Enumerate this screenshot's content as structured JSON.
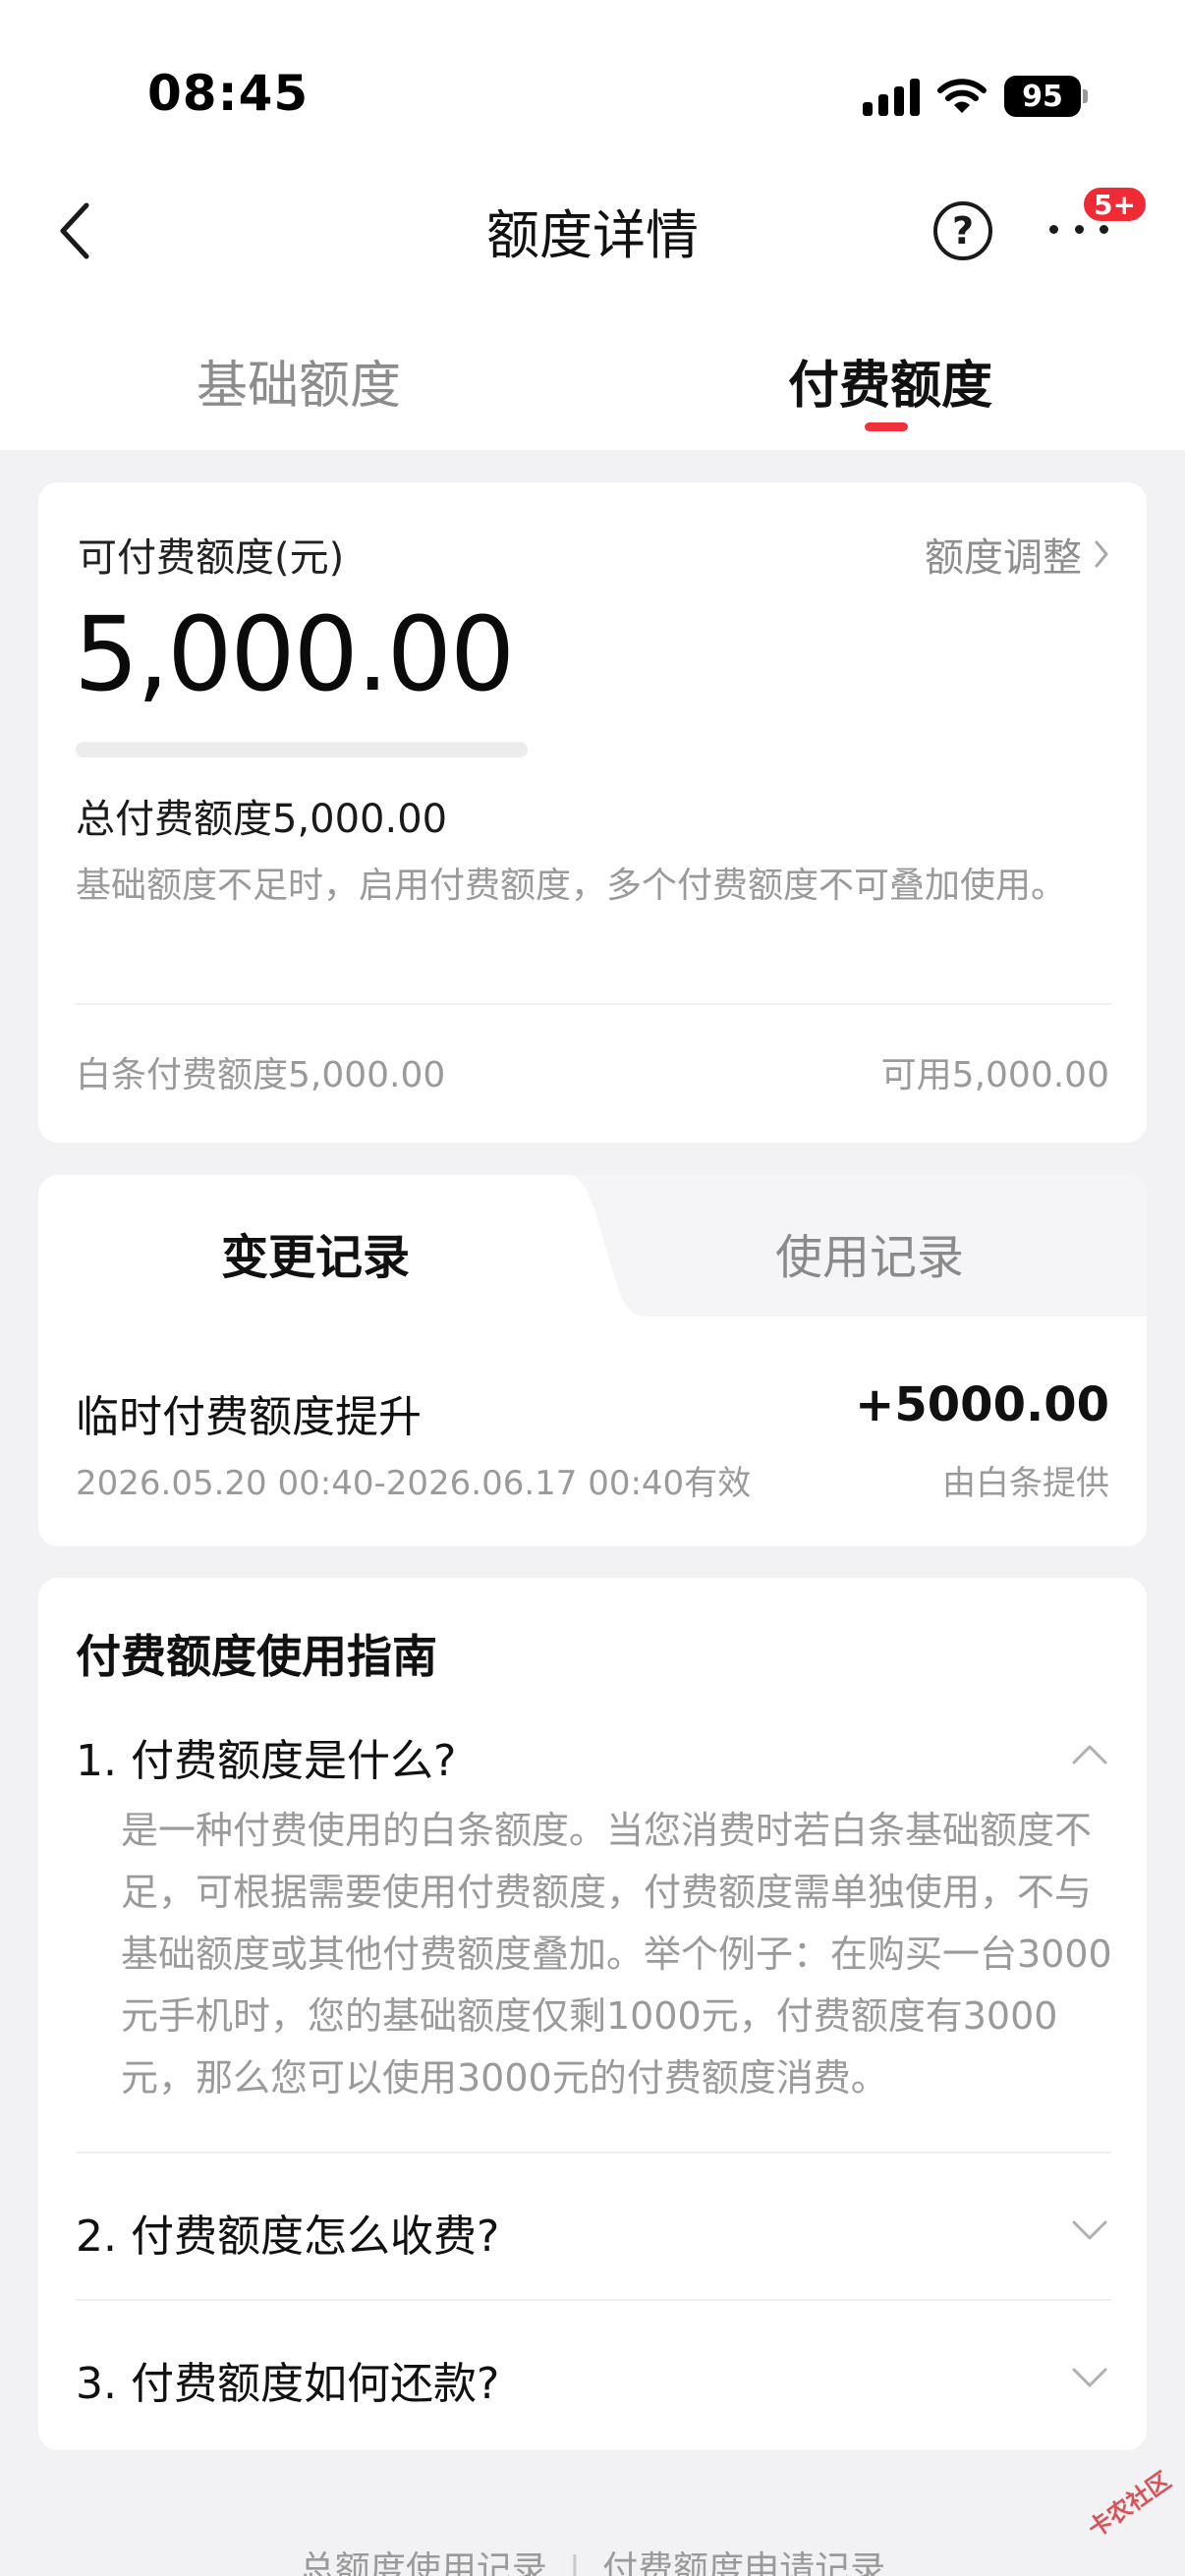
{
  "status_bar": {
    "time": "08:45",
    "battery": "95"
  },
  "header": {
    "title": "额度详情",
    "help_label": "?",
    "badge": "5+"
  },
  "tabs": [
    {
      "label": "基础额度",
      "active": false
    },
    {
      "label": "付费额度",
      "active": true
    }
  ],
  "summary": {
    "available_label": "可付费额度(元)",
    "adjust_label": "额度调整",
    "available_amount": "5,000.00",
    "used_fraction": 0,
    "total_text": "总付费额度5,000.00",
    "description": "基础额度不足时，启用付费额度，多个付费额度不可叠加使用。",
    "baitiao_text": "白条付费额度5,000.00",
    "available_text": "可用5,000.00"
  },
  "records": {
    "tabs": [
      {
        "label": "变更记录",
        "active": true
      },
      {
        "label": "使用记录",
        "active": false
      }
    ],
    "items": [
      {
        "title": "临时付费额度提升",
        "amount": "+5000.00",
        "validity": "2026.05.20 00:40-2026.06.17 00:40有效",
        "provider": "由白条提供"
      }
    ]
  },
  "guide": {
    "title": "付费额度使用指南",
    "faqs": [
      {
        "question": "1. 付费额度是什么?",
        "expanded": true,
        "answer": "是一种付费使用的白条额度。当您消费时若白条基础额度不足，可根据需要使用付费额度，付费额度需单独使用，不与基础额度或其他付费额度叠加。举个例子：在购买一台3000元手机时，您的基础额度仅剩1000元，付费额度有3000元，那么您可以使用3000元的付费额度消费。"
      },
      {
        "question": "2. 付费额度怎么收费?",
        "expanded": false
      },
      {
        "question": "3. 付费额度如何还款?",
        "expanded": false
      }
    ]
  },
  "footer": {
    "link_usage": "总额度使用记录",
    "separator": "|",
    "link_apply": "付费额度申请记录"
  },
  "watermark": "卡农社区",
  "colors": {
    "accent": "#f0313c",
    "muted": "#9a9a9a",
    "background": "#f2f2f4"
  }
}
